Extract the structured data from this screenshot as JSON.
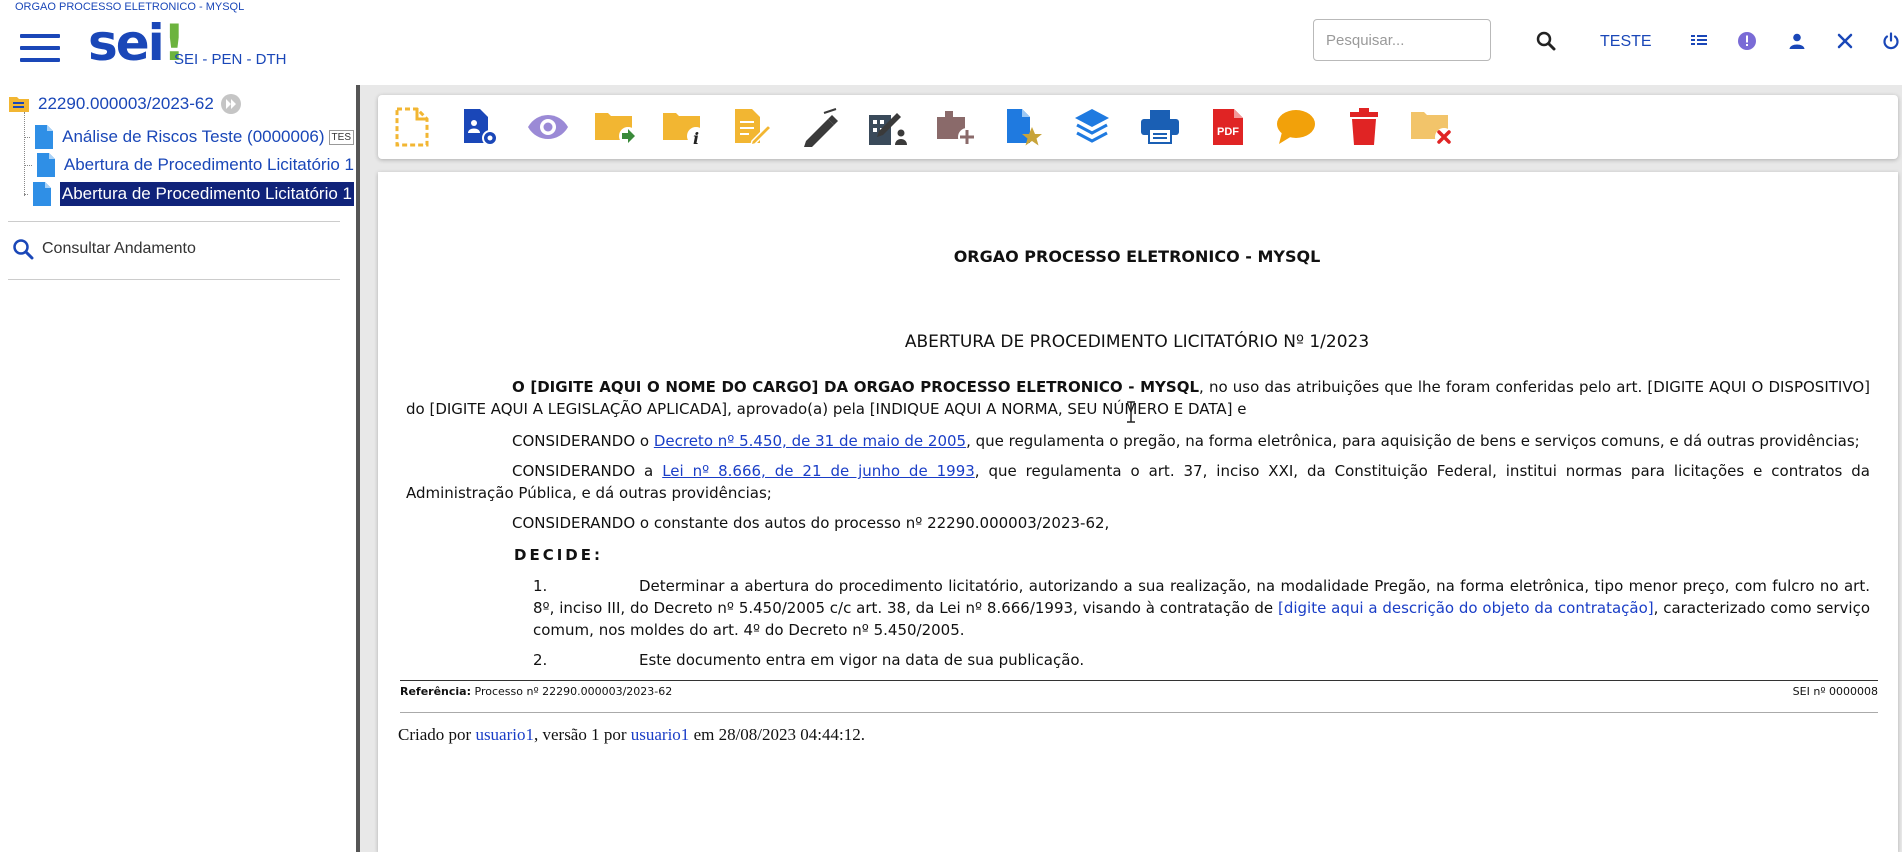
{
  "header": {
    "org_top": "ORGAO PROCESSO ELETRONICO - MYSQL",
    "logo_main": "sei",
    "logo_bang": "!",
    "subsystem": "SEI - PEN - DTH",
    "search_placeholder": "Pesquisar...",
    "user": "TESTE",
    "icons": [
      "menu-icon",
      "search-icon",
      "grid-icon",
      "info-icon",
      "user-icon",
      "tools-icon",
      "power-icon"
    ]
  },
  "tree": {
    "process": "22290.000003/2023-62",
    "docs": [
      {
        "label": "Análise de Riscos Teste (0000006)",
        "tag": "TES"
      },
      {
        "label": "Abertura de Procedimento Licitatório 1"
      },
      {
        "label": "Abertura de Procedimento Licitatório 1"
      }
    ],
    "consult": "Consultar Andamento"
  },
  "toolbar": [
    "new-document-icon",
    "document-settings-icon",
    "view-icon",
    "send-process-icon",
    "process-info-icon",
    "edit-document-icon",
    "sign-icon",
    "sign-block-icon",
    "add-to-block-icon",
    "favorite-document-icon",
    "layers-icon",
    "print-icon",
    "pdf-icon",
    "comment-icon",
    "delete-icon",
    "close-process-icon"
  ],
  "colors": {
    "brand": "#1a47b8",
    "logo_green": "#6cb33e",
    "selected_bg": "#10237a",
    "folder": "#f2b632",
    "pdf": "#e02424"
  },
  "document": {
    "org": "ORGAO PROCESSO ELETRONICO - MYSQL",
    "title": "ABERTURA DE PROCEDIMENTO LICITATÓRIO Nº 1/2023",
    "p1_bold": "O [DIGITE AQUI O NOME DO CARGO] DA ORGAO PROCESSO ELETRONICO - MYSQL",
    "p1_rest": ", no uso das atribuições que lhe foram conferidas pelo art. [DIGITE AQUI O DISPOSITIVO] do [DIGITE AQUI A LEGISLAÇÃO APLICADA], aprovado(a) pela [INDIQUE AQUI A NORMA, SEU NÚMERO E DATA] e",
    "p2_pre": "CONSIDERANDO o ",
    "p2_link": "Decreto nº 5.450, de 31 de maio de 2005",
    "p2_rest": ", que regulamenta o pregão, na forma eletrônica, para aquisição de bens e serviços comuns, e dá outras providências;",
    "p3_pre": "CONSIDERANDO a ",
    "p3_link": "Lei nº 8.666, de 21 de junho de 1993",
    "p3_rest": ", que regulamenta o art. 37, inciso XXI, da Constituição Federal, institui normas para licitações e contratos da Administração Pública,  e dá outras providências;",
    "p4": "CONSIDERANDO o constante dos autos do processo nº 22290.000003/2023-62,",
    "decide": "DECIDE:",
    "item1_num": "1.",
    "item1_pre": "Determinar a abertura do procedimento licitatório, autorizando a sua realização, na modalidade Pregão, na forma eletrônica, tipo menor preço, com fulcro no art. 8º, inciso III, do Decreto nº 5.450/2005 c/c art. 38, da Lei nº 8.666/1993, visando à contratação de ",
    "item1_blue": "[digite aqui a descrição do objeto da contratação]",
    "item1_rest": ", caracterizado como serviço comum, nos moldes do art. 4º do Decreto nº 5.450/2005.",
    "item2_num": "2.",
    "item2": "Este documento entra em vigor na data de sua publicação.",
    "ref_label": "Referência:",
    "ref_value": " Processo nº 22290.000003/2023-62",
    "sei_no": "SEI nº 0000008",
    "created_pre": "Criado por ",
    "created_user1": "usuario1",
    "created_mid": ", versão 1 por ",
    "created_user2": "usuario1",
    "created_post": " em 28/08/2023 04:44:12."
  }
}
